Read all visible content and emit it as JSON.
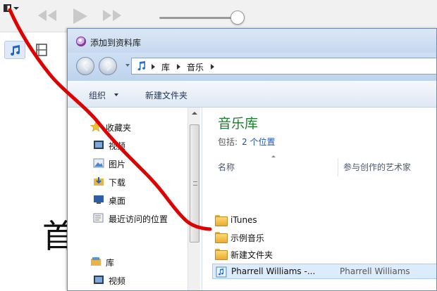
{
  "dialog": {
    "title": "添加到资料库",
    "breadcrumb": [
      "库",
      "音乐"
    ],
    "toolbar": {
      "organize": "组织",
      "new_folder": "新建文件夹"
    }
  },
  "navpane": {
    "favorites": "收藏夹",
    "favorites_items": [
      "视频",
      "图片",
      "下载",
      "桌面",
      "最近访问的位置"
    ],
    "libraries": "库",
    "libraries_items": [
      "视频"
    ]
  },
  "content": {
    "title": "音乐库",
    "includes_label": "包括:",
    "includes_link": "2 个位置",
    "columns": {
      "name": "名称",
      "artist": "参与创作的艺术家"
    },
    "rows": [
      {
        "name": "iTunes",
        "artist": ""
      },
      {
        "name": "示例音乐",
        "artist": ""
      },
      {
        "name": "新建文件夹",
        "artist": ""
      },
      {
        "name": "Pharrell Williams -...",
        "artist": "Pharrell Williams"
      }
    ]
  },
  "background": {
    "large_glyph": "首"
  },
  "colors": {
    "annotation": "#e00000",
    "library_title": "#1e7d2e",
    "link": "#1b55b9"
  }
}
